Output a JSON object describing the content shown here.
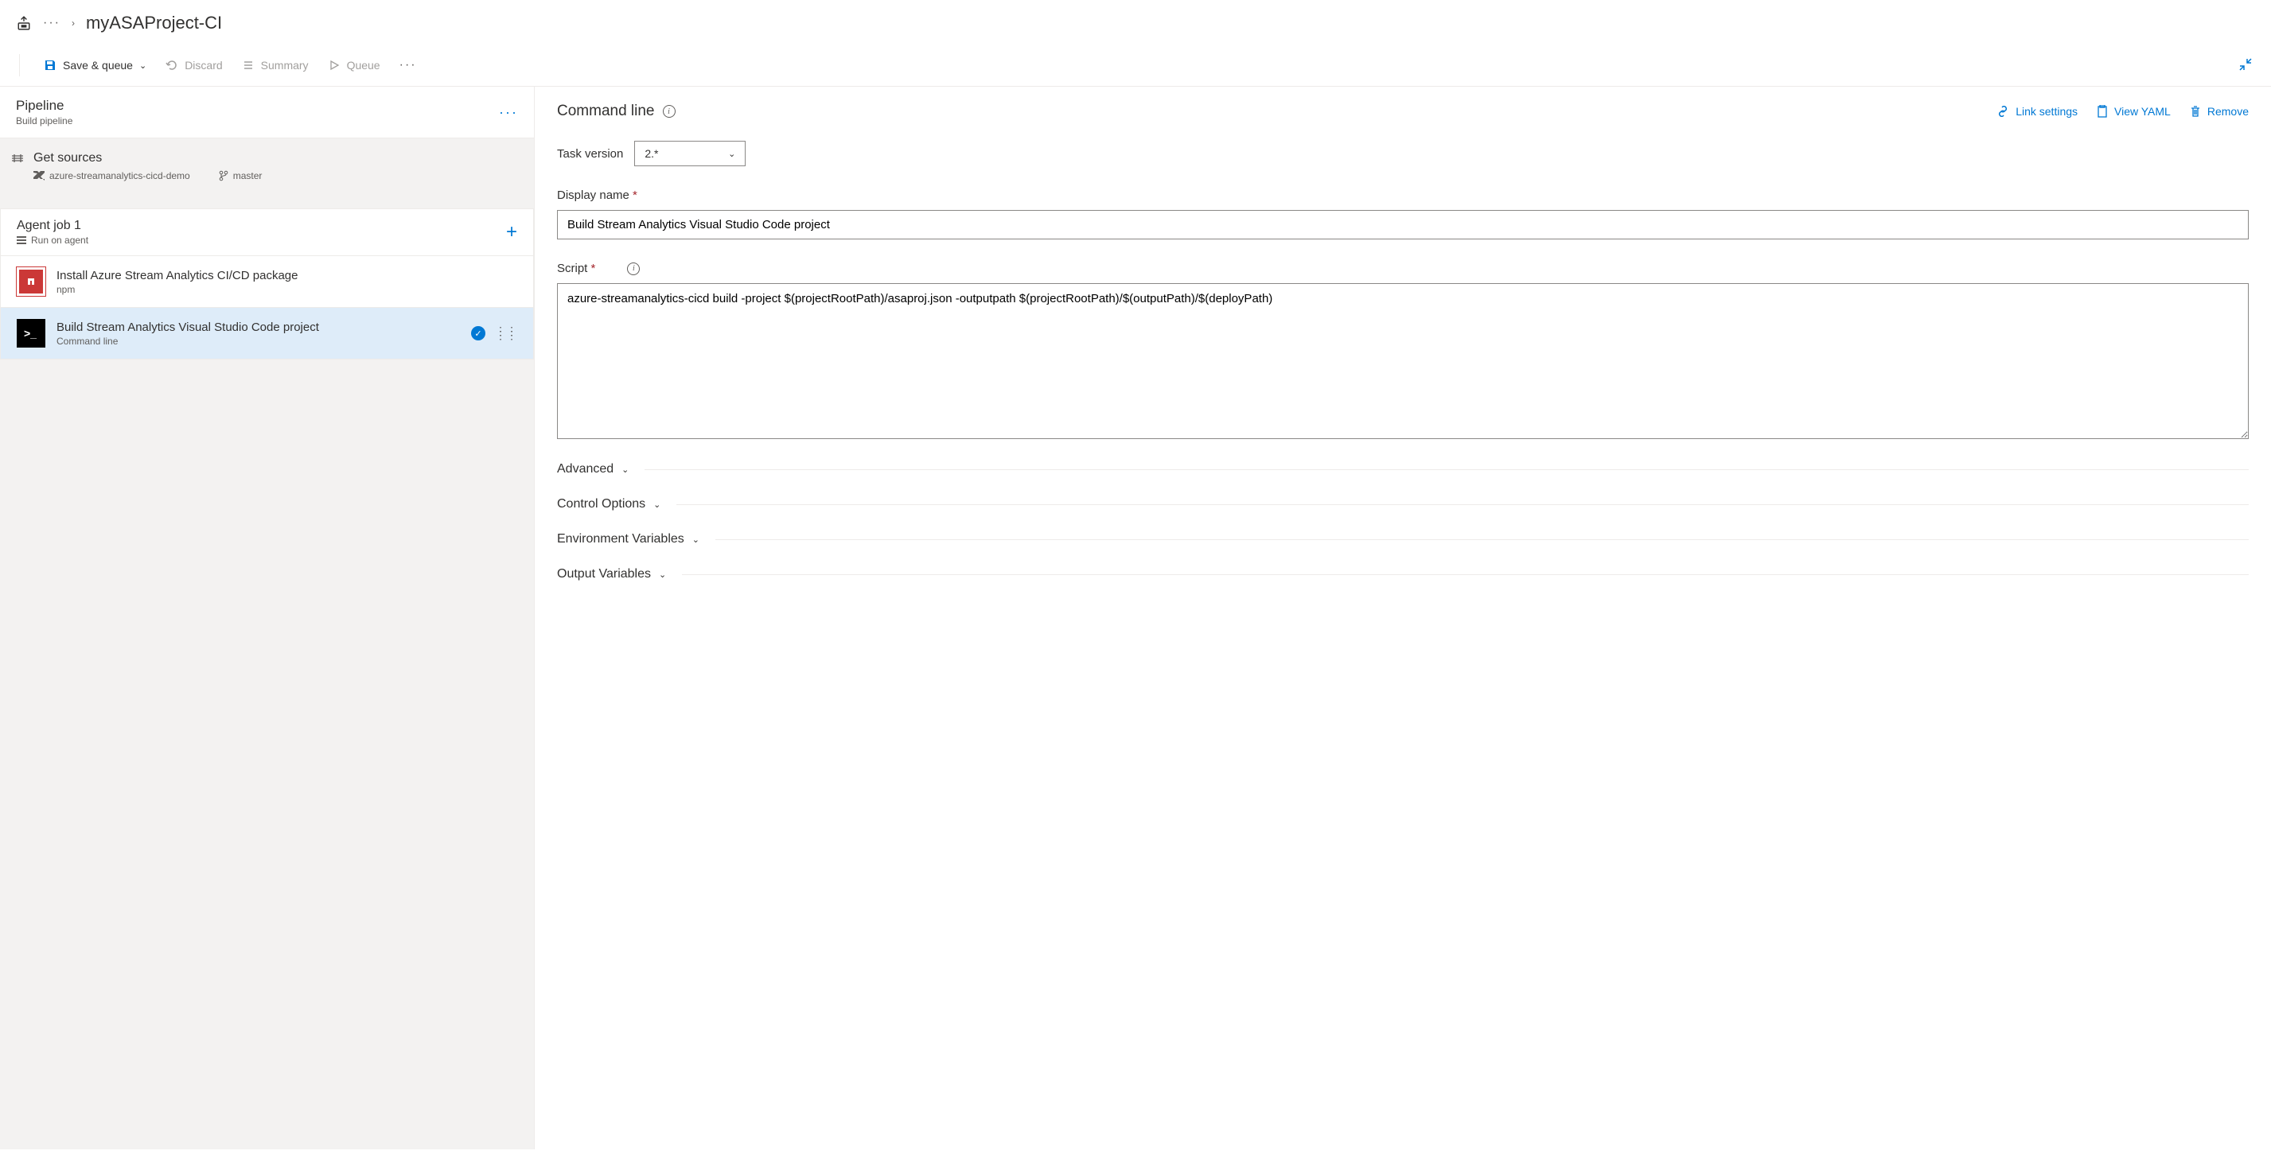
{
  "breadcrumb": {
    "title": "myASAProject-CI"
  },
  "toolbar": {
    "save_queue": "Save & queue",
    "discard": "Discard",
    "summary": "Summary",
    "queue": "Queue"
  },
  "pipeline": {
    "title": "Pipeline",
    "subtitle": "Build pipeline"
  },
  "get_sources": {
    "title": "Get sources",
    "repo": "azure-streamanalytics-cicd-demo",
    "branch": "master"
  },
  "agent_job": {
    "title": "Agent job 1",
    "subtitle": "Run on agent"
  },
  "tasks": [
    {
      "title": "Install Azure Stream Analytics CI/CD package",
      "subtitle": "npm"
    },
    {
      "title": "Build Stream Analytics Visual Studio Code project",
      "subtitle": "Command line"
    }
  ],
  "detail": {
    "title": "Command line",
    "actions": {
      "link_settings": "Link settings",
      "view_yaml": "View YAML",
      "remove": "Remove"
    },
    "task_version_label": "Task version",
    "task_version_value": "2.*",
    "display_name_label": "Display name",
    "display_name_value": "Build Stream Analytics Visual Studio Code project",
    "script_label": "Script",
    "script_value": "azure-streamanalytics-cicd build -project $(projectRootPath)/asaproj.json -outputpath $(projectRootPath)/$(outputPath)/$(deployPath)",
    "sections": {
      "advanced": "Advanced",
      "control_options": "Control Options",
      "env_vars": "Environment Variables",
      "output_vars": "Output Variables"
    }
  }
}
